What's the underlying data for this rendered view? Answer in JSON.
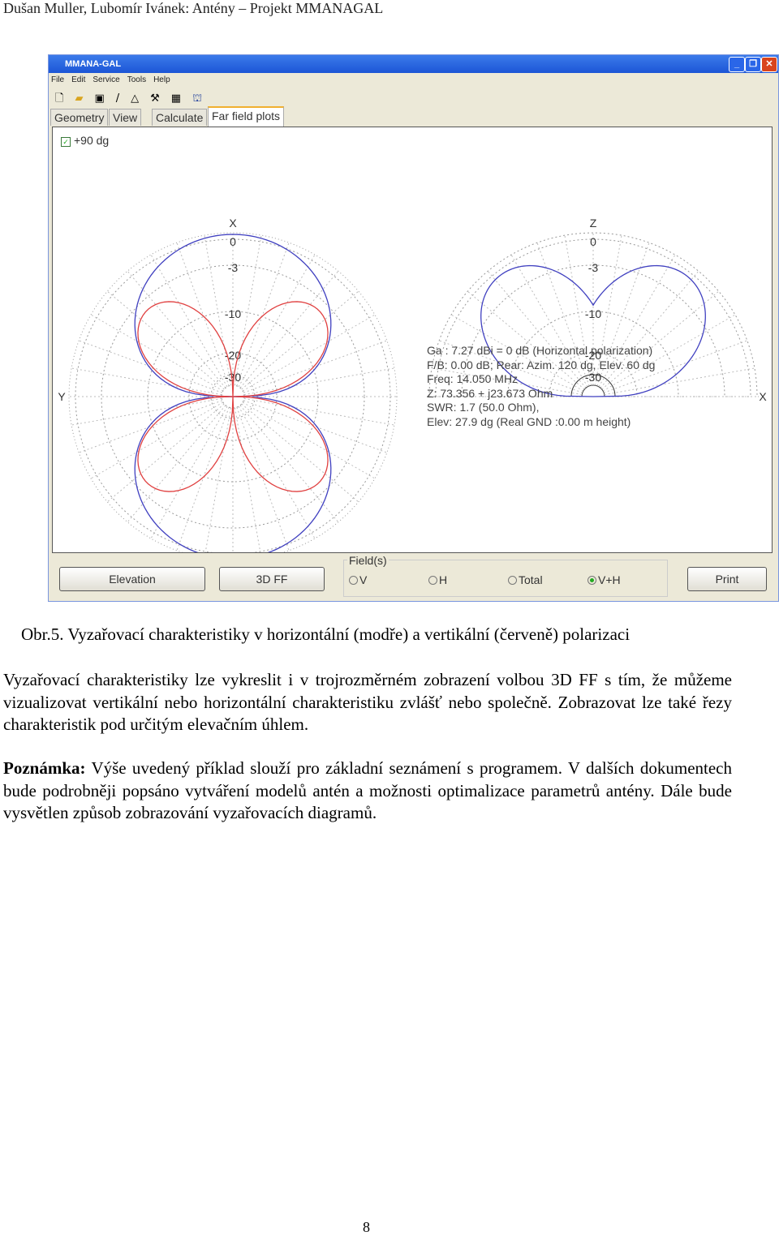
{
  "header": "Dušan Muller, Lubomír Ivánek: Antény – Projekt MMANAGAL",
  "window": {
    "title": "MMANA-GAL",
    "menu": [
      "File",
      "Edit",
      "Service",
      "Tools",
      "Help"
    ],
    "toolbar_icons": [
      "new-file-icon",
      "open-folder-icon",
      "save-icon",
      "wire-icon",
      "triangle-icon",
      "tools-icon",
      "calculator-icon",
      "binoculars-icon"
    ],
    "tabs": [
      "Geometry",
      "View",
      "Calculate",
      "Far field plots"
    ],
    "active_tab": "Far field plots",
    "checkbox": {
      "label": "+90 dg",
      "checked": true
    },
    "azimuth_plot": {
      "axis_top": "X",
      "axis_left": "Y",
      "scale": [
        "0",
        "-3",
        "-10",
        "-20",
        "-30"
      ]
    },
    "elevation_plot": {
      "axis_top": "Z",
      "axis_right": "X",
      "scale": [
        "0",
        "-3",
        "-10",
        "-20",
        "-30"
      ]
    },
    "colors": {
      "horizontal": "#4040c0",
      "vertical": "#e04040"
    },
    "info": [
      "Ga : 7.27 dBi = 0 dB  (Horizontal polarization)",
      "F/B: 0.00 dB; Rear: Azim. 120 dg,  Elev. 60 dg",
      "Freq: 14.050 MHz",
      "Z: 73.356 + j23.673 Ohm",
      "SWR: 1.7 (50.0 Ohm),",
      "Elev: 27.9 dg (Real GND  :0.00 m height)"
    ],
    "buttons": {
      "elevation": "Elevation",
      "ff3d": "3D FF",
      "print": "Print"
    },
    "fields": {
      "legend": "Field(s)",
      "options": [
        "V",
        "H",
        "Total",
        "V+H"
      ],
      "selected": "V+H"
    }
  },
  "caption": "Obr.5. Vyzařovací charakteristiky v horizontální (modře) a vertikální (červeně) polarizaci",
  "para1": "Vyzařovací charakteristiky lze vykreslit i v trojrozměrném zobrazení volbou 3D FF s tím, že můžeme vizualizovat vertikální nebo horizontální charakteristiku zvlášť nebo společně. Zobrazovat lze také řezy charakteristik pod určitým elevačním úhlem.",
  "note_label": "Poznámka:",
  "note_text": " Výše uvedený příklad slouží pro základní seznámení s programem. V dalších dokumentech bude podrobněji popsáno vytváření modelů antén a možnosti optimalizace parametrů antény. Dále bude vysvětlen způsob zobrazování vyzařovacích diagramů.",
  "page_number": "8"
}
